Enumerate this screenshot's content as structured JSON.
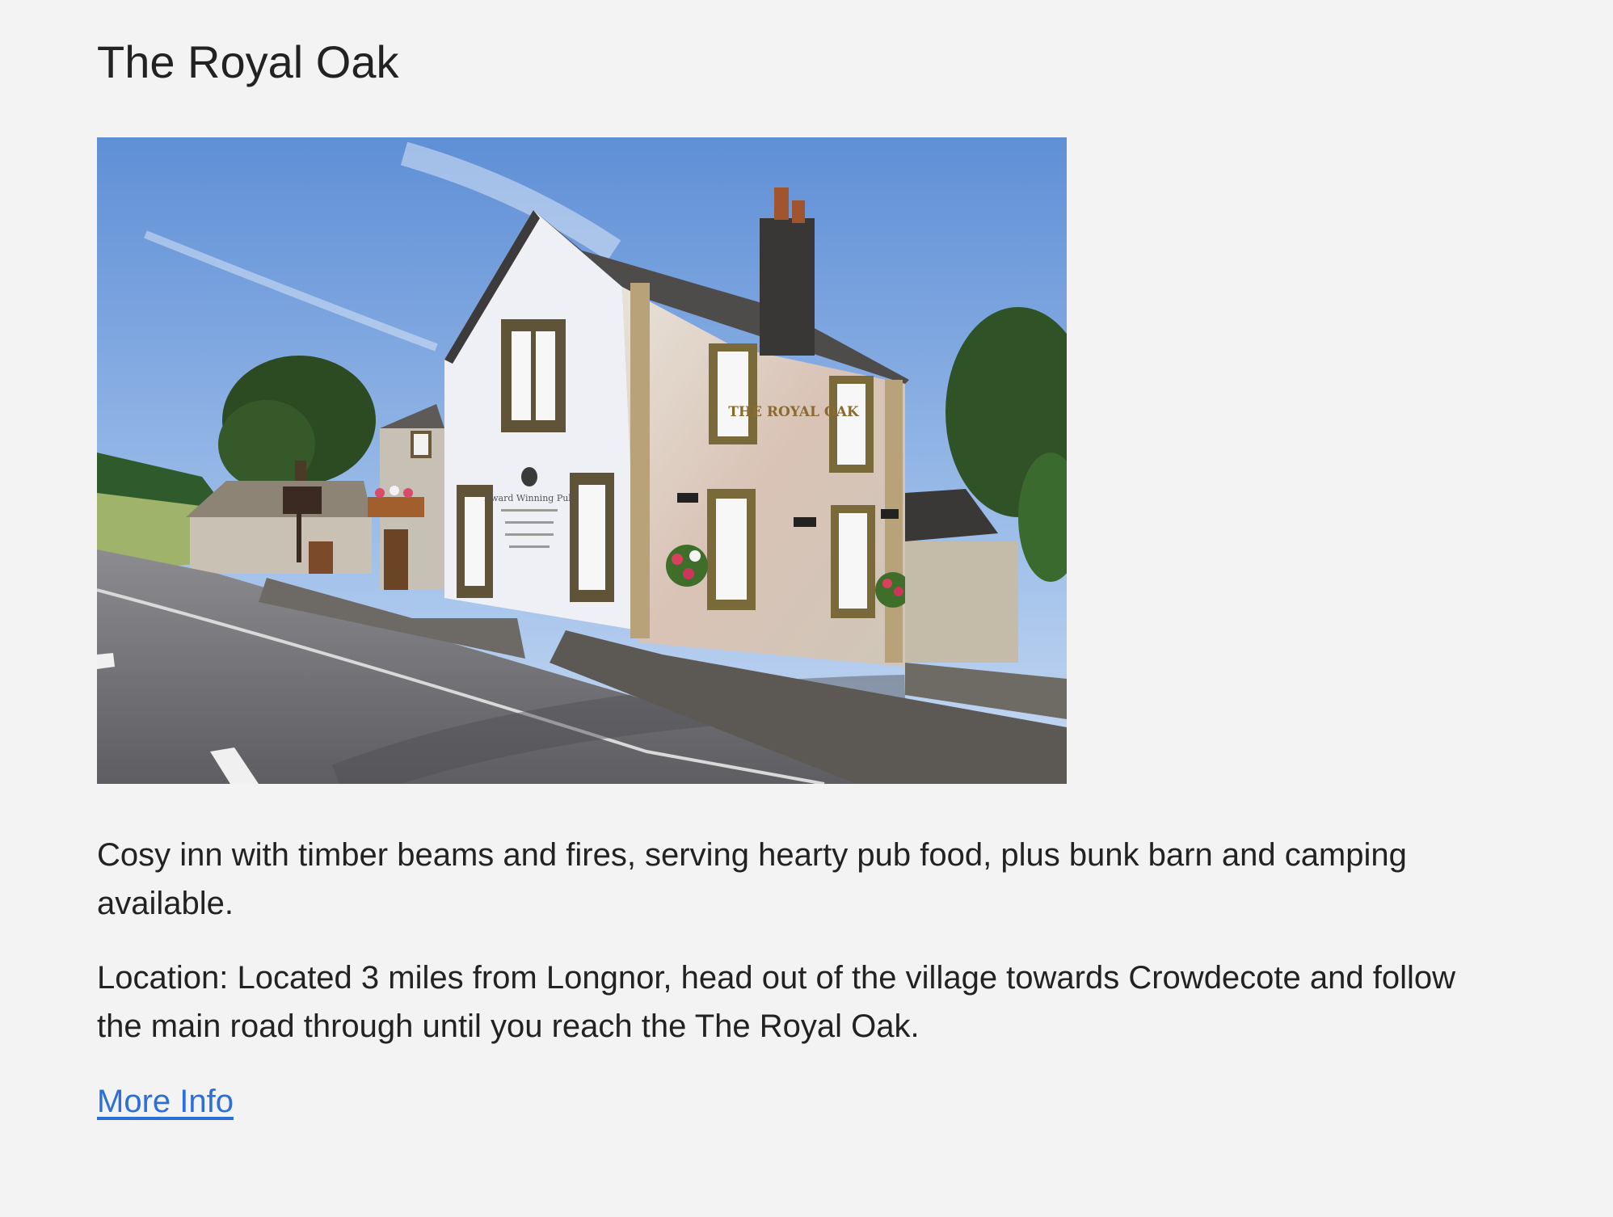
{
  "venue": {
    "title": "The Royal Oak",
    "photo_alt": "The Royal Oak",
    "description": "Cosy inn with timber beams and fires, serving hearty pub food, plus bunk barn and camping available.",
    "location": "Location: Located 3 miles from Longnor, head out of the village towards Crowdecote and follow the main road through until you reach the The Royal Oak.",
    "more_info_label": "More Info"
  },
  "photo_signage": {
    "pub_sign": "THE ROYAL OAK",
    "wall_sign_heading": "Award Winning Pub"
  },
  "colors": {
    "background": "#f3f3f3",
    "text": "#222222",
    "link": "#2c6fd8"
  }
}
